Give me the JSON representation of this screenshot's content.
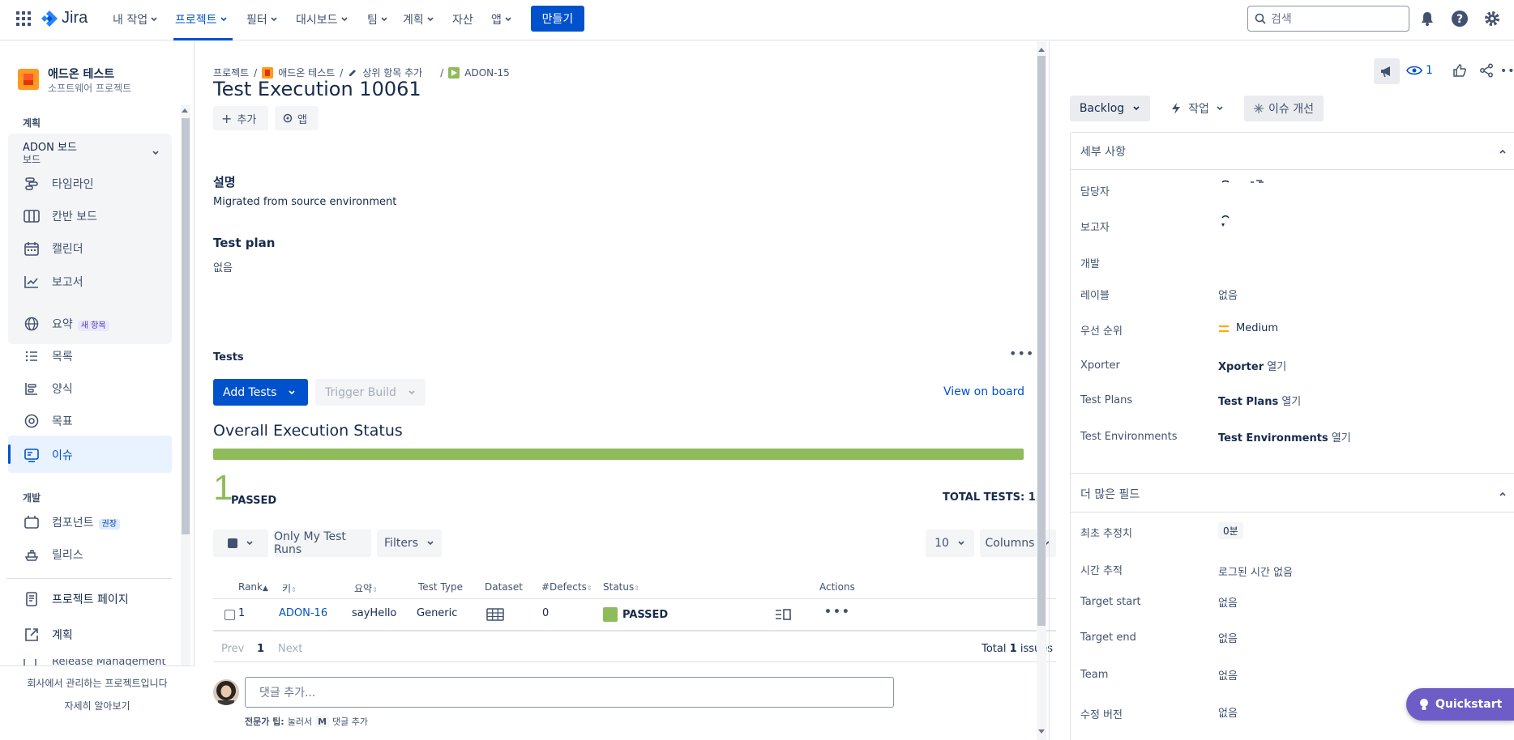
{
  "topnav": {
    "brand": "Jira",
    "items": [
      "내 작업",
      "프로젝트",
      "필터",
      "대시보드",
      "팀",
      "계획",
      "자산",
      "앱"
    ],
    "create_label": "만들기",
    "search_placeholder": "검색"
  },
  "sidebar": {
    "project_name": "애드온 테스트",
    "project_type": "소프트웨어 프로젝트",
    "section_plan": "계획",
    "board_name": "ADON 보드",
    "board_sub": "보드",
    "board_items": [
      "타임라인",
      "칸반 보드",
      "캘린더",
      "보고서"
    ],
    "items": [
      "요약",
      "목록",
      "양식",
      "목표",
      "이슈"
    ],
    "new_badge": "새 항목",
    "section_dev": "개발",
    "dev_items": [
      "컴포넌트",
      "릴리스"
    ],
    "recommended_badge": "권장",
    "bottom_items": [
      "프로젝트 페이지",
      "계획",
      "Release Management"
    ],
    "footer_text": "회사에서 관리하는 프로젝트입니다",
    "footer_link": "자세히 알아보기"
  },
  "main": {
    "breadcrumbs": [
      "프로젝트",
      "애드온 테스트",
      "상위 항목 추가",
      "ADON-15"
    ],
    "title": "Test Execution 10061",
    "add_label": "추가",
    "apps_label": "앱",
    "description_heading": "설명",
    "description_text": "Migrated from source environment",
    "test_plan_heading": "Test plan",
    "test_plan_value": "없음",
    "tests_heading": "Tests",
    "add_tests_label": "Add Tests",
    "trigger_build_label": "Trigger Build",
    "view_on_board_label": "View on board",
    "overall_status_heading": "Overall Execution Status",
    "progress_passed_fraction": 1.0,
    "passed_count": "1",
    "passed_label": "PASSED",
    "total_tests": "TOTAL TESTS: 1",
    "only_my_runs_label": "Only My Test Runs",
    "filters_label": "Filters",
    "page_size": "10",
    "columns_label": "Columns",
    "table_headers": [
      "Rank",
      "키",
      "요약",
      "Test Type",
      "Dataset",
      "#Defects",
      "Status",
      "Actions"
    ],
    "rows": [
      {
        "rank": "1",
        "key": "ADON-16",
        "summary": "sayHello",
        "test_type": "Generic",
        "defects": "0",
        "status": "PASSED"
      }
    ],
    "pager_prev": "Prev",
    "pager_page": "1",
    "pager_next": "Next",
    "total_issues_prefix": "Total",
    "total_issues_count": "1",
    "total_issues_suffix": "issues",
    "comment_placeholder": "댓글 추가...",
    "tip_bold": "전문가 팁:",
    "tip_press": "눌러서",
    "tip_key": "M",
    "tip_action": "댓글 추가"
  },
  "rightpanel": {
    "watch_count": "1",
    "status_label": "Backlog",
    "action_label": "작업",
    "improve_label": "이슈 개선",
    "details_heading": "세부 사항",
    "fields": [
      {
        "label": "담당자",
        "value": ""
      },
      {
        "label": "보고자",
        "value": ""
      },
      {
        "label": "개발",
        "value": ""
      },
      {
        "label": "레이블",
        "value": "없음"
      },
      {
        "label": "우선 순위",
        "value": "Medium"
      },
      {
        "label": "Xporter",
        "bold": "Xporter",
        "value": "열기"
      },
      {
        "label": "Test Plans",
        "bold": "Test Plans",
        "value": "열기"
      },
      {
        "label": "Test Environments",
        "bold": "Test Environments",
        "value": "열기"
      }
    ],
    "more_heading": "더 많은 필드",
    "more_fields": [
      {
        "label": "최초 추정치",
        "value": "0분"
      },
      {
        "label": "시간 추적",
        "value": "로그된 시간 없음"
      },
      {
        "label": "Target start",
        "value": "없음"
      },
      {
        "label": "Target end",
        "value": "없음"
      },
      {
        "label": "Team",
        "value": "없음"
      },
      {
        "label": "수정 버전",
        "value": "없음"
      }
    ],
    "quickstart_label": "Quickstart"
  },
  "colors": {
    "primary": "#0052cc",
    "passed": "#8fbc5a",
    "sidebar_selected": "#e9f2ff",
    "quickstart": "#6e5dc6",
    "priority_medium": "#ffab00"
  }
}
